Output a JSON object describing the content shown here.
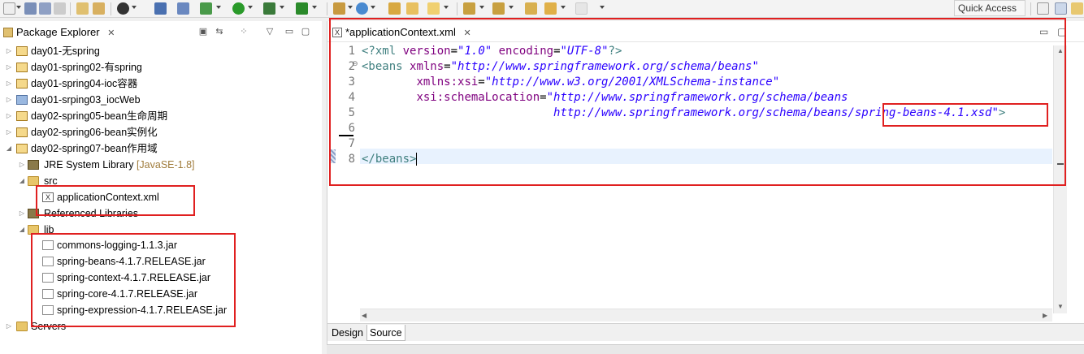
{
  "toolbar": {
    "quick_access": "Quick Access"
  },
  "package_explorer": {
    "title": "Package Explorer",
    "items": [
      {
        "label": "day01-无spring",
        "level": 0,
        "expanded": false,
        "icon": "project-icon"
      },
      {
        "label": "day01-spring02-有spring",
        "level": 0,
        "expanded": false,
        "icon": "project-icon"
      },
      {
        "label": "day01-spring04-ioc容器",
        "level": 0,
        "expanded": false,
        "icon": "project-icon"
      },
      {
        "label": "day01-srping03_iocWeb",
        "level": 0,
        "expanded": false,
        "icon": "web-project-icon"
      },
      {
        "label": "day02-spring05-bean生命周期",
        "level": 0,
        "expanded": false,
        "icon": "project-icon"
      },
      {
        "label": "day02-spring06-bean实例化",
        "level": 0,
        "expanded": false,
        "icon": "project-icon"
      },
      {
        "label": "day02-spring07-bean作用域",
        "level": 0,
        "expanded": true,
        "icon": "project-icon"
      },
      {
        "label": "JRE System Library",
        "tag": "[JavaSE-1.8]",
        "level": 1,
        "expanded": false,
        "icon": "library-icon"
      },
      {
        "label": "src",
        "level": 1,
        "expanded": true,
        "icon": "folder-icon"
      },
      {
        "label": "applicationContext.xml",
        "level": 2,
        "icon": "xml-file-icon"
      },
      {
        "label": "Referenced Libraries",
        "level": 1,
        "expanded": false,
        "icon": "library-icon"
      },
      {
        "label": "lib",
        "level": 1,
        "expanded": true,
        "icon": "folder-icon"
      },
      {
        "label": "commons-logging-1.1.3.jar",
        "level": 2,
        "icon": "jar-icon"
      },
      {
        "label": "spring-beans-4.1.7.RELEASE.jar",
        "level": 2,
        "icon": "jar-icon"
      },
      {
        "label": "spring-context-4.1.7.RELEASE.jar",
        "level": 2,
        "icon": "jar-icon"
      },
      {
        "label": "spring-core-4.1.7.RELEASE.jar",
        "level": 2,
        "icon": "jar-icon"
      },
      {
        "label": "spring-expression-4.1.7.RELEASE.jar",
        "level": 2,
        "icon": "jar-icon"
      },
      {
        "label": "Servers",
        "level": 0,
        "expanded": false,
        "icon": "folder-icon"
      }
    ]
  },
  "editor": {
    "tab_title": "*applicationContext.xml",
    "line_numbers": [
      "1",
      "2",
      "3",
      "4",
      "5",
      "6",
      "7",
      "8"
    ],
    "fold_marker": "⊖",
    "lines": [
      {
        "t1": "<?xml ",
        "a1": "version",
        "e1": "=",
        "v1": "\"1.0\"",
        "sp1": " ",
        "a2": "encoding",
        "e2": "=",
        "v2": "\"UTF-8\"",
        "end": "?>"
      },
      {
        "t1": "<beans ",
        "a1": "xmlns",
        "e1": "=",
        "v1": "\"http://www.springframework.org/schema/beans\""
      },
      {
        "indent": "        ",
        "a1": "xmlns:xsi",
        "e1": "=",
        "v1": "\"http://www.w3.org/2001/XMLSchema-instance\""
      },
      {
        "indent": "        ",
        "a1": "xsi:schemaLocation",
        "e1": "=",
        "v1": "\"http://www.springframework.org/schema/beans"
      },
      {
        "indent": "                            ",
        "v1": "http://www.springframework.org/schema/beans/spring-beans-4.1.xsd\"",
        "end": ">"
      },
      {
        "text": ""
      },
      {
        "text": ""
      },
      {
        "t1": "</beans>"
      }
    ],
    "bottom_tabs": [
      "Design",
      "Source"
    ]
  }
}
